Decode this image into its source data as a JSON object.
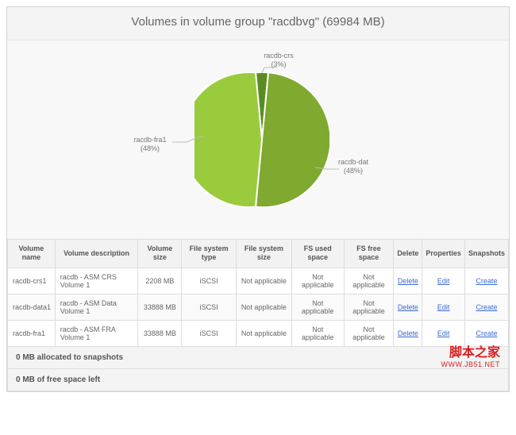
{
  "title": "Volumes in volume group \"racdbvg\" (69984 MB)",
  "chart_data": {
    "type": "pie",
    "slices": [
      {
        "name": "racdb-crs",
        "pct": 3,
        "label": "racdb-crs\n(3%)",
        "color": "#5b8c22"
      },
      {
        "name": "racdb-dat",
        "pct": 48,
        "label": "racdb-dat\n(48%)",
        "color": "#7fa92f"
      },
      {
        "name": "racdb-fra1",
        "pct": 48,
        "label": "racdb-fra1\n(48%)",
        "color": "#9acb3c"
      }
    ]
  },
  "table": {
    "headers": [
      "Volume name",
      "Volume description",
      "Volume size",
      "File system type",
      "File system size",
      "FS used space",
      "FS free space",
      "Delete",
      "Properties",
      "Snapshots"
    ],
    "rows": [
      {
        "name": "racdb-crs1",
        "desc": "racdb - ASM CRS Volume 1",
        "size": "2208 MB",
        "fstype": "iSCSI",
        "fssize": "Not applicable",
        "fsused": "Not applicable",
        "fsfree": "Not applicable",
        "delete": "Delete",
        "props": "Edit",
        "snaps": "Create"
      },
      {
        "name": "racdb-data1",
        "desc": "racdb - ASM Data Volume 1",
        "size": "33888 MB",
        "fstype": "iSCSI",
        "fssize": "Not applicable",
        "fsused": "Not applicable",
        "fsfree": "Not applicable",
        "delete": "Delete",
        "props": "Edit",
        "snaps": "Create"
      },
      {
        "name": "racdb-fra1",
        "desc": "racdb - ASM FRA Volume 1",
        "size": "33888 MB",
        "fstype": "iSCSI",
        "fssize": "Not applicable",
        "fsused": "Not applicable",
        "fsfree": "Not applicable",
        "delete": "Delete",
        "props": "Edit",
        "snaps": "Create"
      }
    ]
  },
  "footer": {
    "snapshots": "0 MB allocated to snapshots",
    "free": "0 MB of free space left"
  },
  "watermark": {
    "cn": "脚本之家",
    "url": "WWW.JB51.NET"
  }
}
